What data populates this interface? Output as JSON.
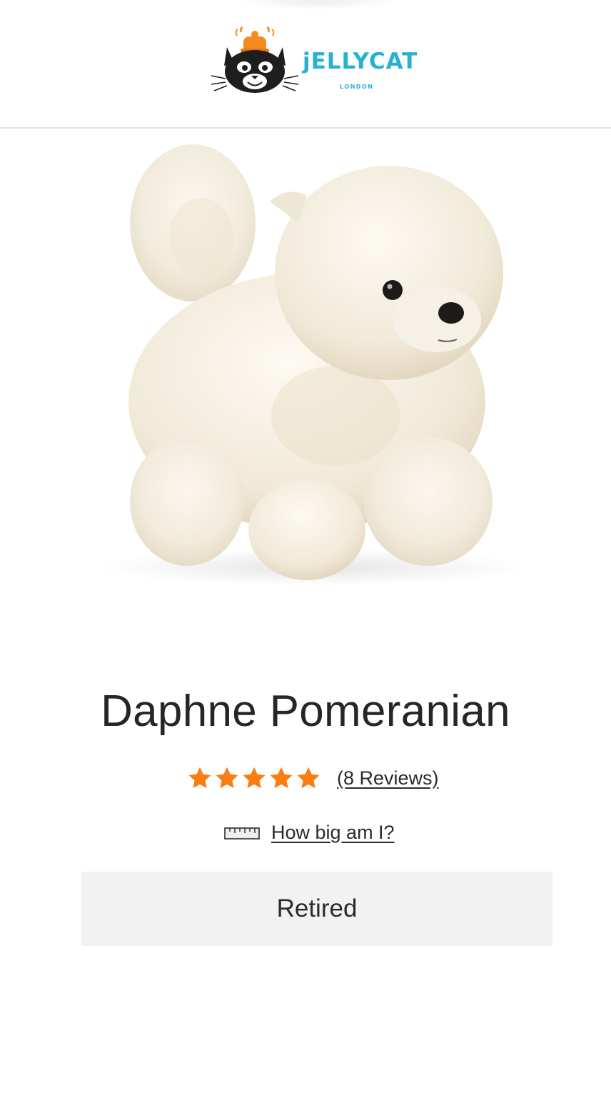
{
  "header": {
    "brand_name": "jELLYCAT",
    "brand_location": "LONDON",
    "logo_icon": "cat-face-icon",
    "brand_color": "#27b2d4",
    "logo_accent_color": "#f38b1f"
  },
  "product": {
    "name": "Daphne Pomeranian",
    "image_icon": "plush-dog-image",
    "rating": {
      "stars": 5,
      "max_stars": 5,
      "star_color": "#f97d12",
      "reviews_label": "(8 Reviews)"
    },
    "size_guide": {
      "icon": "ruler-icon",
      "label": "How big am I?"
    },
    "status": "Retired"
  }
}
